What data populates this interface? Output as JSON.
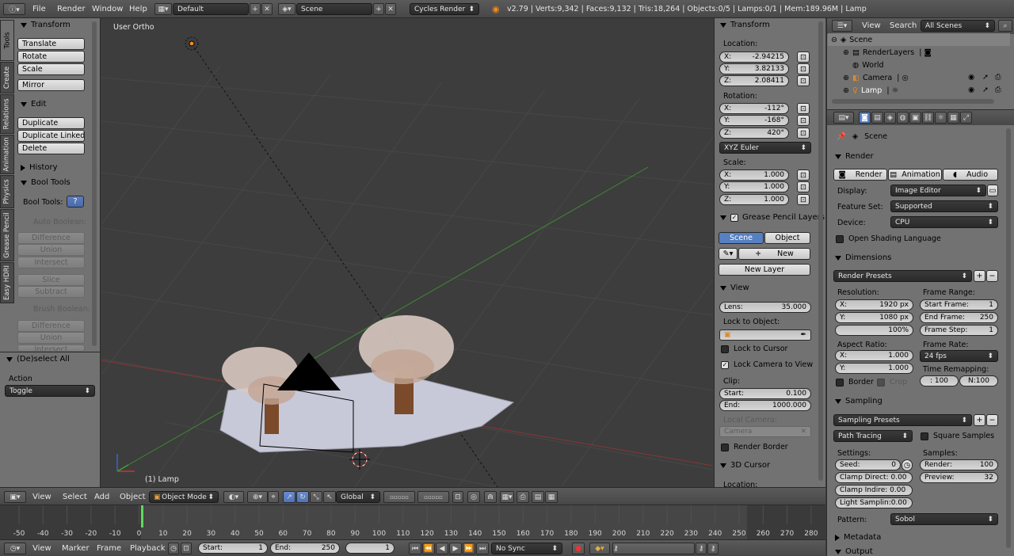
{
  "app": {
    "info_menu_icon": "info-icon",
    "menu": [
      "File",
      "Render",
      "Window",
      "Help"
    ],
    "layout": "Default",
    "scene": "Scene",
    "engine": "Cycles Render",
    "stats": "v2.79 | Verts:9,342 | Faces:9,132 | Tris:18,264 | Objects:0/5 | Lamps:0/1 | Mem:189.96M | Lamp"
  },
  "tabs": [
    "Tools",
    "Create",
    "Relations",
    "Animation",
    "Physics",
    "Grease Pencil",
    "Easy HDRI"
  ],
  "tools": {
    "transform_title": "Transform",
    "translate": "Translate",
    "rotate": "Rotate",
    "scale": "Scale",
    "mirror": "Mirror",
    "edit_title": "Edit",
    "duplicate": "Duplicate",
    "duplicate_linked": "Duplicate Linked",
    "delete": "Delete",
    "history_title": "History",
    "booltools_title": "Bool Tools",
    "booltools_label": "Bool Tools:",
    "auto_boolean": "Auto Boolean:",
    "difference": "Difference",
    "union": "Union",
    "intersect": "Intersect",
    "slice": "Slice",
    "subtract": "Subtract",
    "brush_boolean": "Brush Boolean:",
    "intersect2": "Intersect"
  },
  "operator": {
    "title": "(De)select All",
    "action_label": "Action",
    "action_value": "Toggle"
  },
  "viewport": {
    "view_label": "User Ortho",
    "object_label": "(1) Lamp"
  },
  "npanel": {
    "transform_title": "Transform",
    "location_label": "Location:",
    "loc": [
      {
        "a": "X:",
        "v": "-2.94215"
      },
      {
        "a": "Y:",
        "v": "3.82133"
      },
      {
        "a": "Z:",
        "v": "2.08411"
      }
    ],
    "rotation_label": "Rotation:",
    "rot": [
      {
        "a": "X:",
        "v": "-112°"
      },
      {
        "a": "Y:",
        "v": "-168°"
      },
      {
        "a": "Z:",
        "v": "420°"
      }
    ],
    "rotation_mode": "XYZ Euler",
    "scale_label": "Scale:",
    "scl": [
      {
        "a": "X:",
        "v": "1.000"
      },
      {
        "a": "Y:",
        "v": "1.000"
      },
      {
        "a": "Z:",
        "v": "1.000"
      }
    ],
    "gp_title": "Grease Pencil Layers",
    "gp_scene": "Scene",
    "gp_object": "Object",
    "gp_new": "New",
    "gp_new_layer": "New Layer",
    "view_title": "View",
    "lens_label": "Lens:",
    "lens_value": "35.000",
    "lock_object_label": "Lock to Object:",
    "lock_cursor": "Lock to Cursor",
    "lock_camera": "Lock Camera to View",
    "clip_label": "Clip:",
    "clip_start_label": "Start:",
    "clip_start": "0.100",
    "clip_end_label": "End:",
    "clip_end": "1000.000",
    "local_camera_label": "Local Camera:",
    "local_camera_value": "Camera",
    "render_border": "Render Border",
    "cursor_title": "3D Cursor",
    "cursor_location": "Location:"
  },
  "viewport_header": {
    "menus": [
      "View",
      "Select",
      "Add",
      "Object"
    ],
    "mode": "Object Mode",
    "orientation": "Global"
  },
  "outliner": {
    "menus": [
      "View",
      "Search"
    ],
    "filter": "All Scenes",
    "items": [
      "Scene",
      "RenderLayers",
      "World",
      "Camera",
      "Lamp"
    ]
  },
  "properties": {
    "context": "Scene",
    "render_title": "Render",
    "render_btn": "Render",
    "animation_btn": "Animation",
    "audio_btn": "Audio",
    "display_label": "Display:",
    "display_value": "Image Editor",
    "feature_label": "Feature Set:",
    "feature_value": "Supported",
    "device_label": "Device:",
    "device_value": "CPU",
    "osl": "Open Shading Language",
    "dimensions_title": "Dimensions",
    "render_presets": "Render Presets",
    "resolution_label": "Resolution:",
    "res_x_label": "X:",
    "res_x": "1920 px",
    "res_y_label": "Y:",
    "res_y": "1080 px",
    "res_pct": "100%",
    "frame_range_label": "Frame Range:",
    "start_frame_label": "Start Frame:",
    "start_frame": "1",
    "end_frame_label": "End Frame:",
    "end_frame": "250",
    "frame_step_label": "Frame Step:",
    "frame_step": "1",
    "aspect_label": "Aspect Ratio:",
    "asp_x_label": "X:",
    "asp_x": "1.000",
    "asp_y_label": "Y:",
    "asp_y": "1.000",
    "frame_rate_label": "Frame Rate:",
    "frame_rate": "24 fps",
    "time_remap_label": "Time Remapping:",
    "remap_old": ": 100",
    "remap_new": "N:100",
    "border": "Border",
    "crop": "Crop",
    "sampling_title": "Sampling",
    "sampling_presets": "Sampling Presets",
    "integrator": "Path Tracing",
    "square_samples": "Square Samples",
    "settings_label": "Settings:",
    "seed_label": "Seed:",
    "seed": "0",
    "clamp_direct": "Clamp Direct: 0.00",
    "clamp_indirect": "Clamp Indire: 0.00",
    "light_sampling": "Light Samplin:0.00",
    "samples_label": "Samples:",
    "render_samples_label": "Render:",
    "render_samples": "100",
    "preview_samples_label": "Preview:",
    "preview_samples": "32",
    "pattern_label": "Pattern:",
    "pattern_value": "Sobol",
    "metadata_title": "Metadata",
    "output_title": "Output"
  },
  "timeline": {
    "ticks": [
      "-50",
      "-40",
      "-30",
      "-20",
      "-10",
      "0",
      "10",
      "20",
      "30",
      "40",
      "50",
      "60",
      "70",
      "80",
      "90",
      "100",
      "110",
      "120",
      "130",
      "140",
      "150",
      "160",
      "170",
      "180",
      "190",
      "200",
      "210",
      "220",
      "230",
      "240",
      "250",
      "260",
      "270",
      "280"
    ],
    "current_frame_value": 0,
    "menus": [
      "View",
      "Marker",
      "Frame",
      "Playback"
    ],
    "start_label": "Start:",
    "start": "1",
    "end_label": "End:",
    "end": "250",
    "current": "1",
    "sync": "No Sync"
  },
  "colors": {
    "viewport_bg": "#3d3d3d",
    "panel_bg": "#727272",
    "header_bg": "#505050",
    "selection_blue": "#5680c2",
    "x_axis": "#a03030",
    "y_axis": "#4a9a3a",
    "playhead": "#5fd85f"
  }
}
